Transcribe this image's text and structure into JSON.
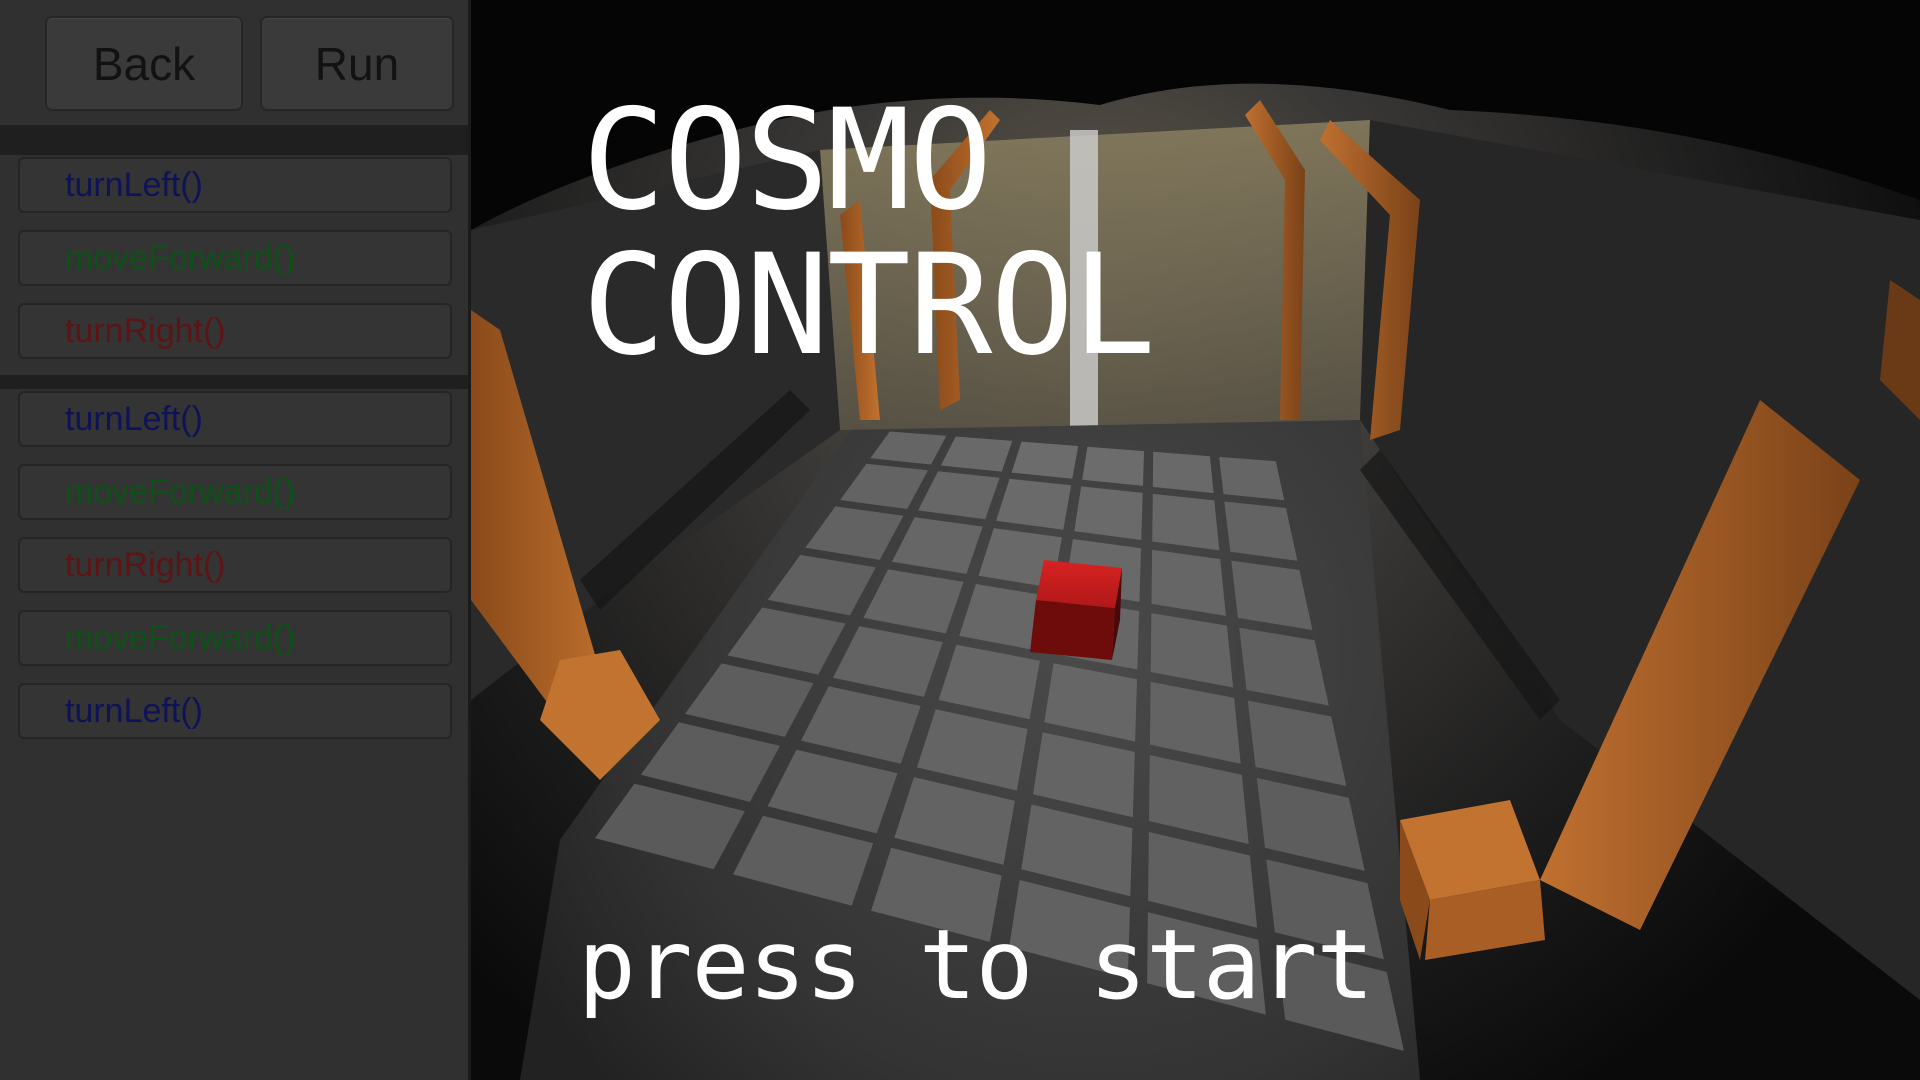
{
  "toolbar": {
    "back_label": "Back",
    "run_label": "Run"
  },
  "command_queue": [
    {
      "label": "turnLeft()",
      "color": "#0e1357"
    },
    {
      "label": "moveForward()",
      "color": "#0c5216"
    },
    {
      "label": "turnRight()",
      "color": "#5c1414"
    }
  ],
  "program": [
    {
      "label": "turnLeft()",
      "color": "#0e1357"
    },
    {
      "label": "moveForward()",
      "color": "#0c5216"
    },
    {
      "label": "turnRight()",
      "color": "#5c1414"
    },
    {
      "label": "moveForward()",
      "color": "#0c5216"
    },
    {
      "label": "turnLeft()",
      "color": "#0e1357"
    }
  ],
  "game": {
    "title_line1": "COSMO",
    "title_line2": "CONTROL",
    "start_prompt": "press to start",
    "board": {
      "columns": 6,
      "rows": 8
    },
    "cube_color": "#c21a1a",
    "trim_color": "#b8662a"
  }
}
